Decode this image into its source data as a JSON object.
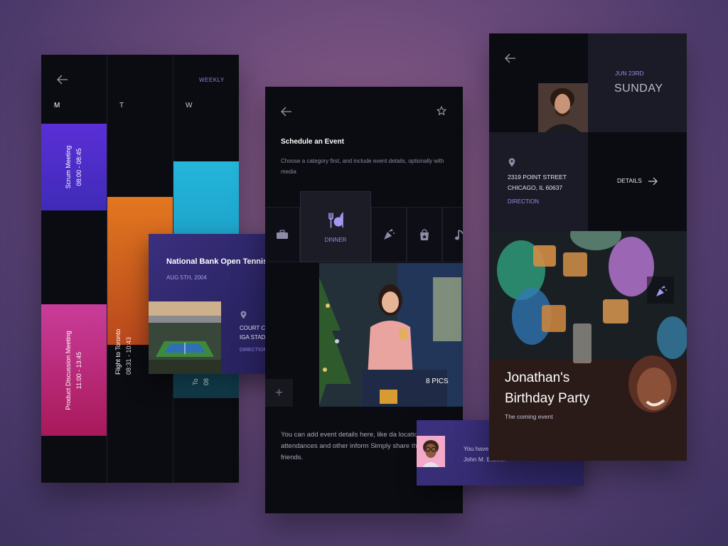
{
  "calendar": {
    "view_label": "WEEKLY",
    "days": [
      "M",
      "T",
      "W"
    ],
    "events": [
      {
        "title": "Scrum Meeting",
        "time": "08:00 - 08:45"
      },
      {
        "title": "Product Discussion Meeting",
        "time": "11:00 - 13:45"
      },
      {
        "title": "Flight to Toronto",
        "time": "08:31 - 10:43"
      },
      {
        "title": "To",
        "time": "08"
      }
    ],
    "colors": {
      "purple": "#4a2fd1",
      "orange": "#e2731f",
      "cyan": "#1fb4d6",
      "pink": "#d1357f"
    }
  },
  "tennis_card": {
    "title": "National Bank Open Tennis",
    "date": "AUG 5TH, 2004",
    "address_line1": "COURT CENTRAL",
    "address_line2": "IGA STADIUM",
    "direction_label": "DIRECTION"
  },
  "schedule": {
    "title": "Schedule an Event",
    "subtitle": "Choose a category first, and include event details, optionally with media",
    "selected_category": "DINNER",
    "categories": [
      "briefcase-icon",
      "dinner-icon",
      "party-popper-icon",
      "shopping-bag-icon",
      "music-note-icon"
    ],
    "media_count_label": "8 PICS",
    "body_text": "You can add event details here, like da location, attendances and other inform Simply share the event with friends."
  },
  "invite": {
    "line1": "You have an event invite from",
    "line2": "John M. Blalock"
  },
  "event_detail": {
    "date": "JUN 23RD",
    "weekday": "SUNDAY",
    "address_line1": "2319 POINT STREET",
    "address_line2": "CHICAGO, IL 60637",
    "direction_label": "DIRECTION",
    "details_label": "DETAILS",
    "title_line1": "Jonathan's",
    "title_line2": "Birthday Party",
    "subtitle": "The coming event"
  },
  "accent": "#9b8ae6"
}
